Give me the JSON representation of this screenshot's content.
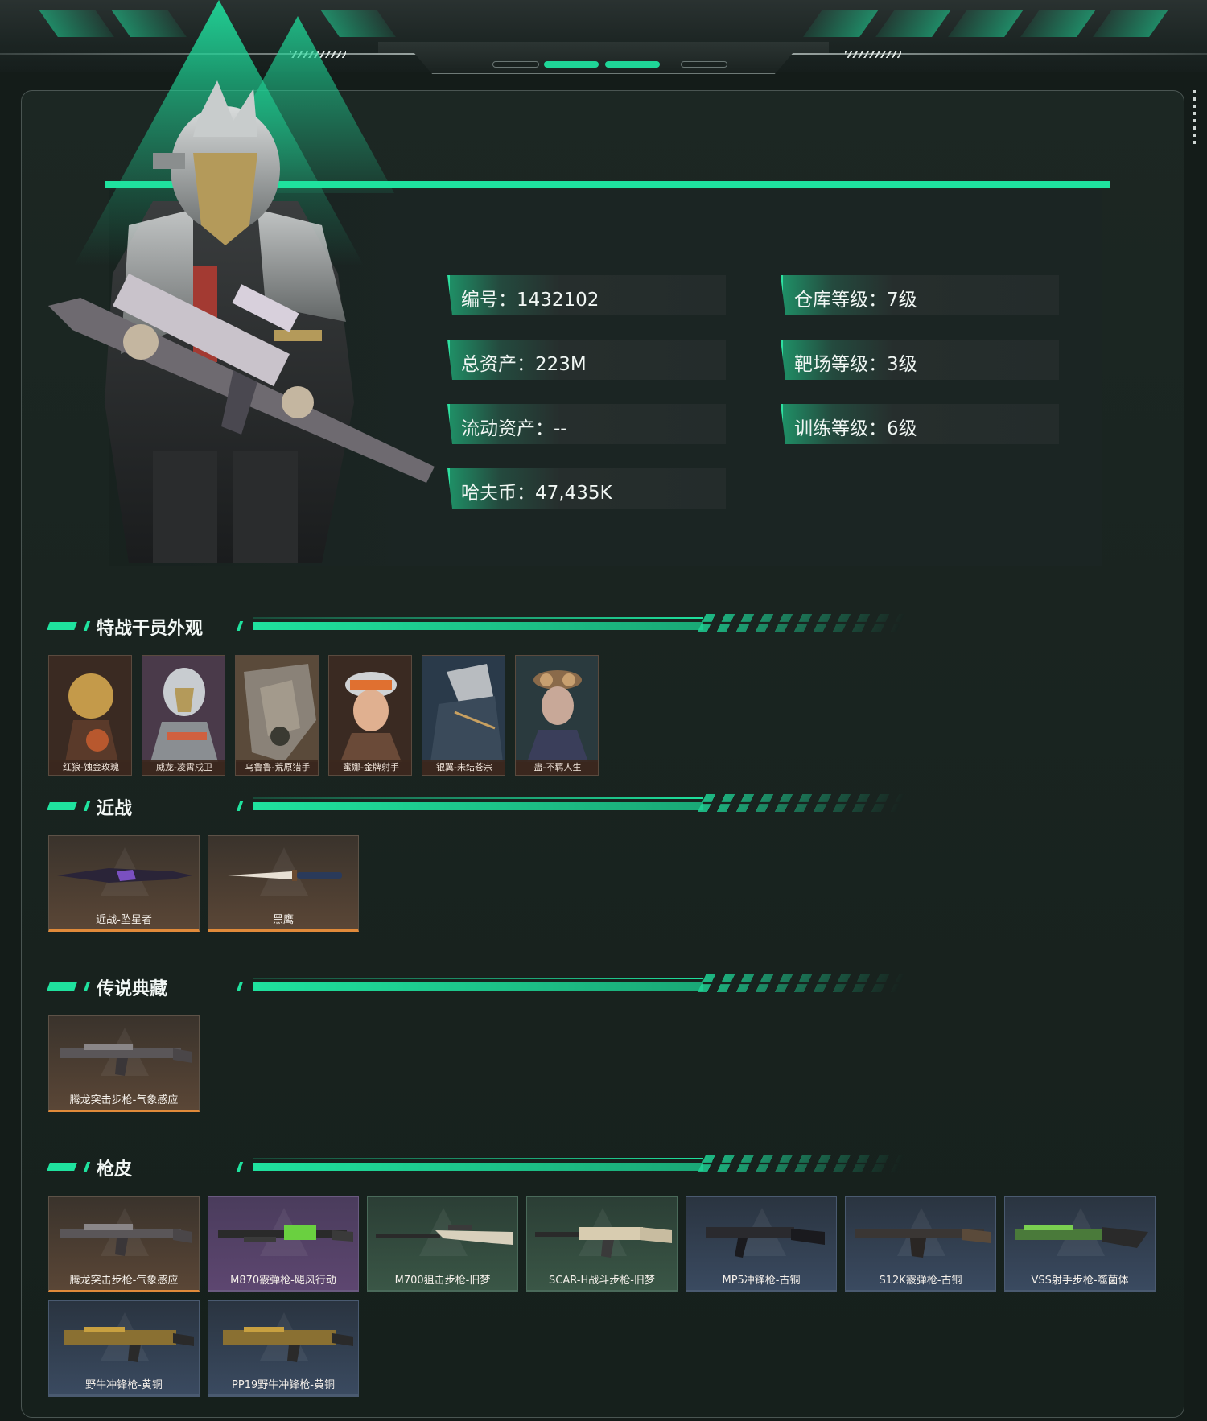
{
  "stats": [
    {
      "label": "编号",
      "value": "1432102"
    },
    {
      "label": "仓库等级",
      "value": "7级"
    },
    {
      "label": "总资产",
      "value": "223M"
    },
    {
      "label": "靶场等级",
      "value": "3级"
    },
    {
      "label": "流动资产",
      "value": "--"
    },
    {
      "label": "训练等级",
      "value": "6级"
    },
    {
      "label": "哈夫币",
      "value": "47,435K"
    }
  ],
  "stat_text": [
    "编号：1432102",
    "仓库等级：7级",
    "总资产：223M",
    "靶场等级：3级",
    "流动资产：--",
    "训练等级：6级",
    "哈夫币：47,435K"
  ],
  "sections": {
    "operators": "特战干员外观",
    "melee": "近战",
    "legendary": "传说典藏",
    "skins": "枪皮"
  },
  "operators": [
    "红狼-蚀金玫瑰",
    "威龙-凌霄戍卫",
    "乌鲁鲁-荒原猎手",
    "蜜娜-金牌射手",
    "银翼-未结苍宗",
    "蛊-不羁人生"
  ],
  "melee": [
    "近战-坠星者",
    "黑鹰"
  ],
  "legendary": [
    "腾龙突击步枪-气象感应"
  ],
  "skins": [
    {
      "name": "腾龙突击步枪-气象感应",
      "rarity": "orange"
    },
    {
      "name": "M870霰弹枪-飓风行动",
      "rarity": "purple"
    },
    {
      "name": "M700狙击步枪-旧梦",
      "rarity": "green"
    },
    {
      "name": "SCAR-H战斗步枪-旧梦",
      "rarity": "green"
    },
    {
      "name": "MP5冲锋枪-古铜",
      "rarity": "blue"
    },
    {
      "name": "S12K霰弹枪-古铜",
      "rarity": "blue"
    },
    {
      "name": "VSS射手步枪-噬菌体",
      "rarity": "blue"
    },
    {
      "name": "野牛冲锋枪-黄铜",
      "rarity": "blue"
    },
    {
      "name": "PP19野牛冲锋枪-黄铜",
      "rarity": "blue"
    }
  ],
  "colors": {
    "accent": "#1fe29e",
    "orange": "#e08a3a",
    "purple": "#9a6ad8",
    "green": "#2fd597",
    "blue": "#4a9ae0"
  }
}
